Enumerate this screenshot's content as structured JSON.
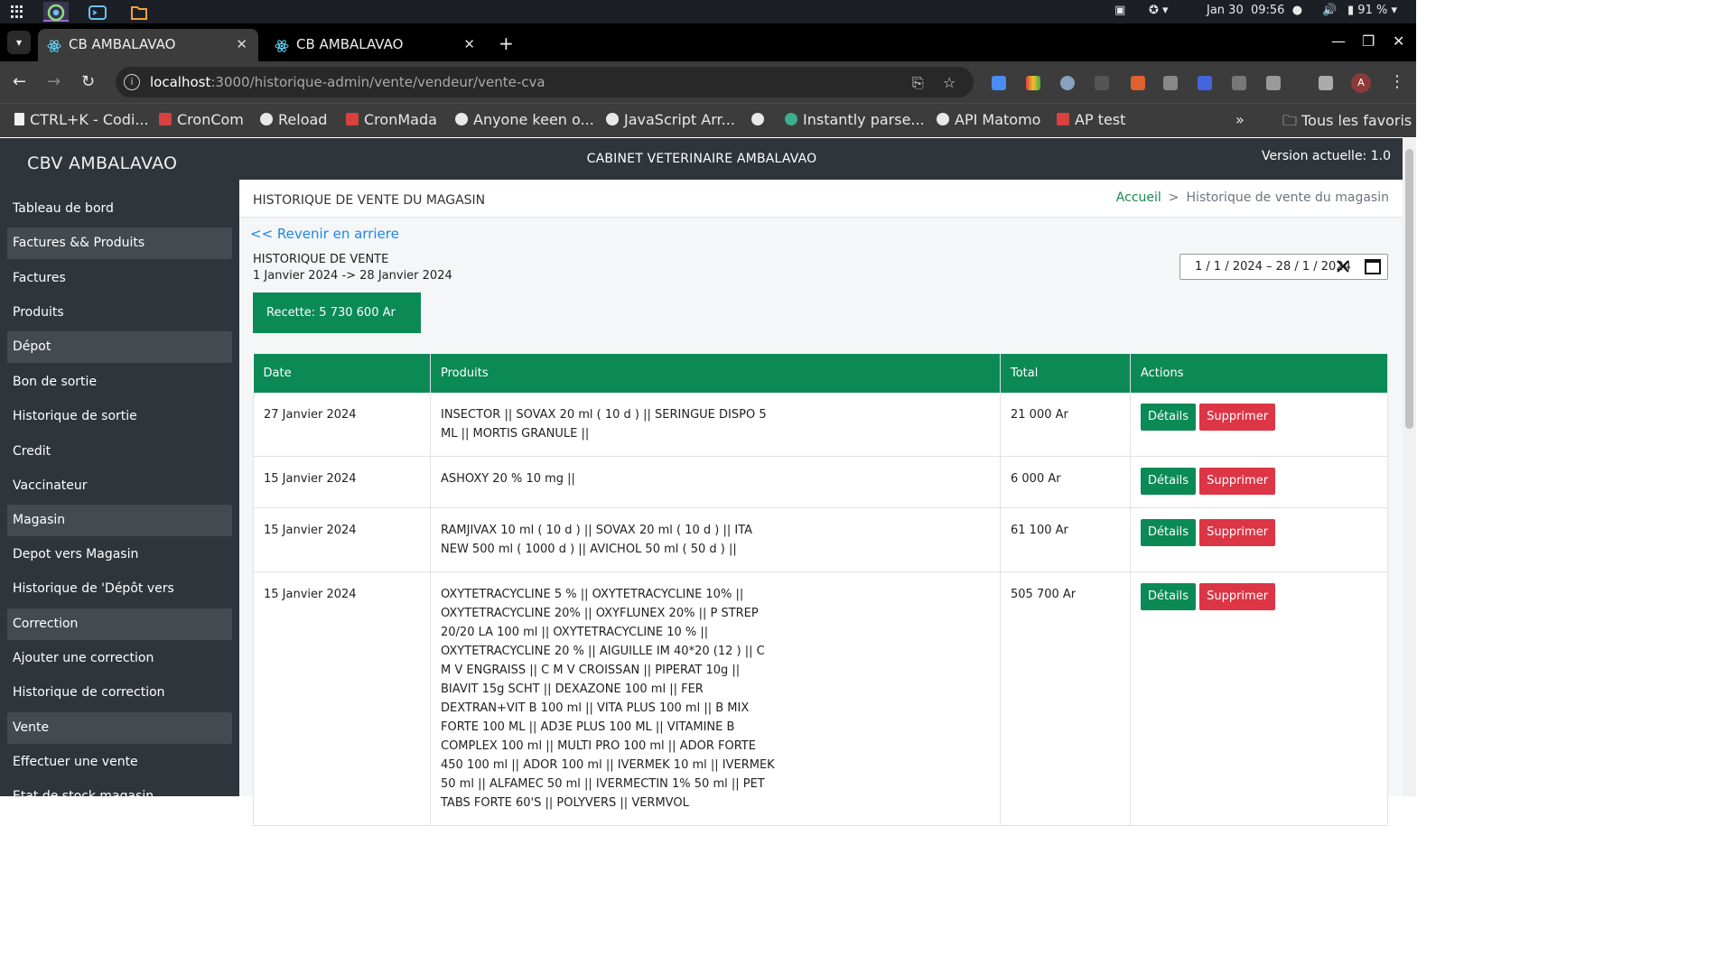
{
  "os": {
    "date": "Jan 30",
    "time": "09:56",
    "battery": "91 %"
  },
  "browser": {
    "tabs": [
      {
        "title": "CB AMBALAVAO",
        "active": true
      },
      {
        "title": "CB AMBALAVAO",
        "active": false
      }
    ],
    "url_host": "localhost",
    "url_path": ":3000/historique-admin/vente/vendeur/vente-cva",
    "avatar_letter": "A",
    "bookmarks": [
      {
        "label": "CTRL+K - Codi...",
        "icon": "doc"
      },
      {
        "label": "CronCom",
        "icon": "sq"
      },
      {
        "label": "Reload",
        "icon": "globe"
      },
      {
        "label": "CronMada",
        "icon": "sq"
      },
      {
        "label": "Anyone keen o...",
        "icon": "globe"
      },
      {
        "label": "JavaScript Arr...",
        "icon": "globe"
      },
      {
        "label": "",
        "icon": "globe"
      },
      {
        "label": "Instantly parse...",
        "icon": "qt"
      },
      {
        "label": "API Matomo",
        "icon": "globe"
      },
      {
        "label": "AP test",
        "icon": "sq"
      }
    ],
    "all_bookmarks": "Tous les favoris"
  },
  "app": {
    "brand": "CBV AMBALAVAO",
    "center_title": "CABINET VETERINAIRE AMBALAVAO",
    "version": "Version actuelle: 1.0",
    "sidebar": [
      {
        "label": "Tableau de bord",
        "group": false
      },
      {
        "label": "Factures && Produits",
        "group": true
      },
      {
        "label": "Factures",
        "group": false
      },
      {
        "label": "Produits",
        "group": false
      },
      {
        "label": "Dépot",
        "group": true
      },
      {
        "label": "Bon de sortie",
        "group": false
      },
      {
        "label": "Historique de sortie",
        "group": false
      },
      {
        "label": "Credit",
        "group": false
      },
      {
        "label": "Vaccinateur",
        "group": false
      },
      {
        "label": "Magasin",
        "group": true
      },
      {
        "label": "Depot vers Magasin",
        "group": false
      },
      {
        "label": "Historique de 'Dépôt vers Magasin'",
        "group": false
      },
      {
        "label": "Correction",
        "group": true
      },
      {
        "label": "Ajouter une correction",
        "group": false
      },
      {
        "label": "Historique de correction",
        "group": false
      },
      {
        "label": "Vente",
        "group": true
      },
      {
        "label": "Effectuer une vente",
        "group": false
      },
      {
        "label": "Etat de stock magasin",
        "group": false
      }
    ],
    "page": {
      "title": "HISTORIQUE DE VENTE DU MAGASIN",
      "breadcrumb_home": "Accueil",
      "breadcrumb_sep": ">",
      "breadcrumb_current": "Historique de vente du magasin",
      "back_link": "<< Revenir en arriere",
      "history_title": "HISTORIQUE DE VENTE",
      "history_range": "1 Janvier 2024 -> 28 Janvier 2024",
      "recette": "Recette: 5 730 600 Ar",
      "date_range": "1 / 1 / 2024 –  28 / 1 / 2024"
    },
    "table": {
      "headers": [
        "Date",
        "Produits",
        "Total",
        "Actions"
      ],
      "details_label": "Détails",
      "delete_label": "Supprimer",
      "rows": [
        {
          "date": "27 Janvier 2024",
          "produits": "INSECTOR || SOVAX 20 ml ( 10 d ) || SERINGUE DISPO 5 ML || MORTIS GRANULE ||",
          "total": "21 000 Ar"
        },
        {
          "date": "15 Janvier 2024",
          "produits": "ASHOXY 20 % 10 mg ||",
          "total": "6 000 Ar"
        },
        {
          "date": "15 Janvier 2024",
          "produits": "RAMJIVAX 10 ml ( 10 d ) || SOVAX 20 ml ( 10 d ) || ITA NEW 500 ml ( 1000 d ) || AVICHOL 50 ml ( 50 d ) ||",
          "total": "61 100 Ar"
        },
        {
          "date": "15 Janvier 2024",
          "produits": "OXYTETRACYCLINE 5 % || OXYTETRACYCLINE 10% || OXYTETRACYCLINE 20% || OXYFLUNEX 20% || P STREP 20/20 LA 100 ml || OXYTETRACYCLINE 10 % || OXYTETRACYCLINE 20 % || AIGUILLE IM 40*20 (12 ) || C M V ENGRAISS || C M V CROISSAN || PIPERAT 10g || BIAVIT 15g SCHT || DEXAZONE 100 ml || FER DEXTRAN+VIT B 100 ml || VITA PLUS 100 ml || B MIX FORTE 100 ML || AD3E PLUS 100 ML || VITAMINE B COMPLEX 100 ml || MULTI PRO 100 ml || ADOR FORTE 450 100 ml || ADOR 100 ml || IVERMEK 10 ml || IVERMEK 50 ml || ALFAMEC 50 ml || IVERMECTIN 1% 50 ml || PET TABS FORTE 60'S || POLYVERS || VERMVOL",
          "total": "505 700 Ar"
        }
      ]
    }
  }
}
